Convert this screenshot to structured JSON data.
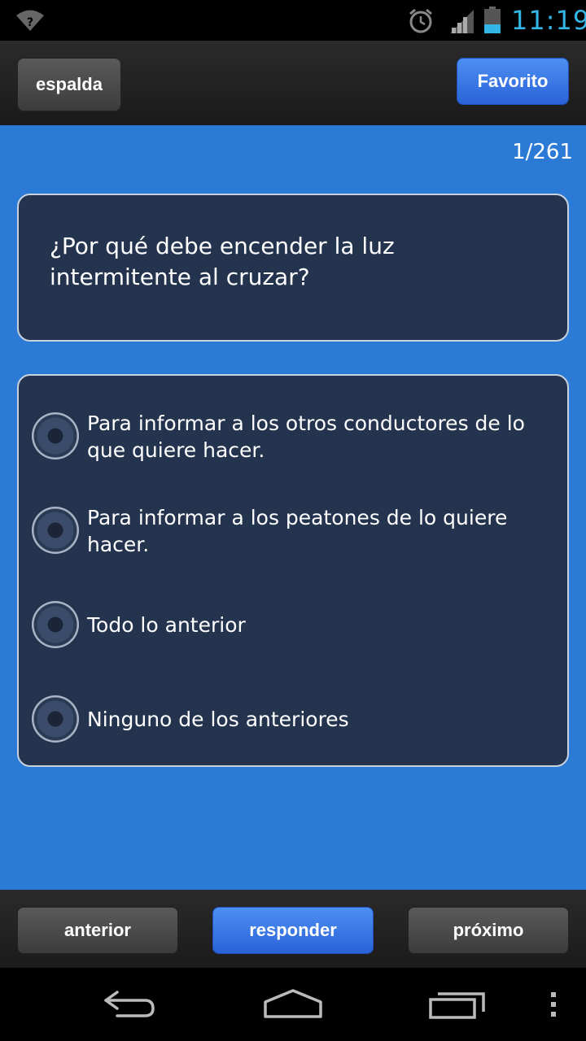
{
  "status_bar": {
    "time": "11:19",
    "icons": [
      "wifi-icon",
      "alarm-clock-icon",
      "signal-icon",
      "battery-icon"
    ],
    "clock_color": "#33b5e5"
  },
  "header": {
    "back_label": "espalda",
    "favorite_label": "Favorito"
  },
  "quiz": {
    "counter": "1/261",
    "question": "¿Por qué debe encender la luz intermitente al cruzar?",
    "options": [
      {
        "label": "Para informar a los otros conductores de lo que quiere hacer."
      },
      {
        "label": "Para informar a los peatones de lo quiere hacer."
      },
      {
        "label": "Todo lo anterior"
      },
      {
        "label": "Ninguno de los anteriores"
      }
    ]
  },
  "footer": {
    "prev_label": "anterior",
    "answer_label": "responder",
    "next_label": "próximo"
  },
  "system_nav": {
    "icons": [
      "back-icon",
      "home-icon",
      "recents-icon",
      "overflow-menu-icon"
    ]
  },
  "colors": {
    "background_blue": "#2a7ad6",
    "card_bg": "#24344e",
    "accent_button": "#3a79e6"
  }
}
